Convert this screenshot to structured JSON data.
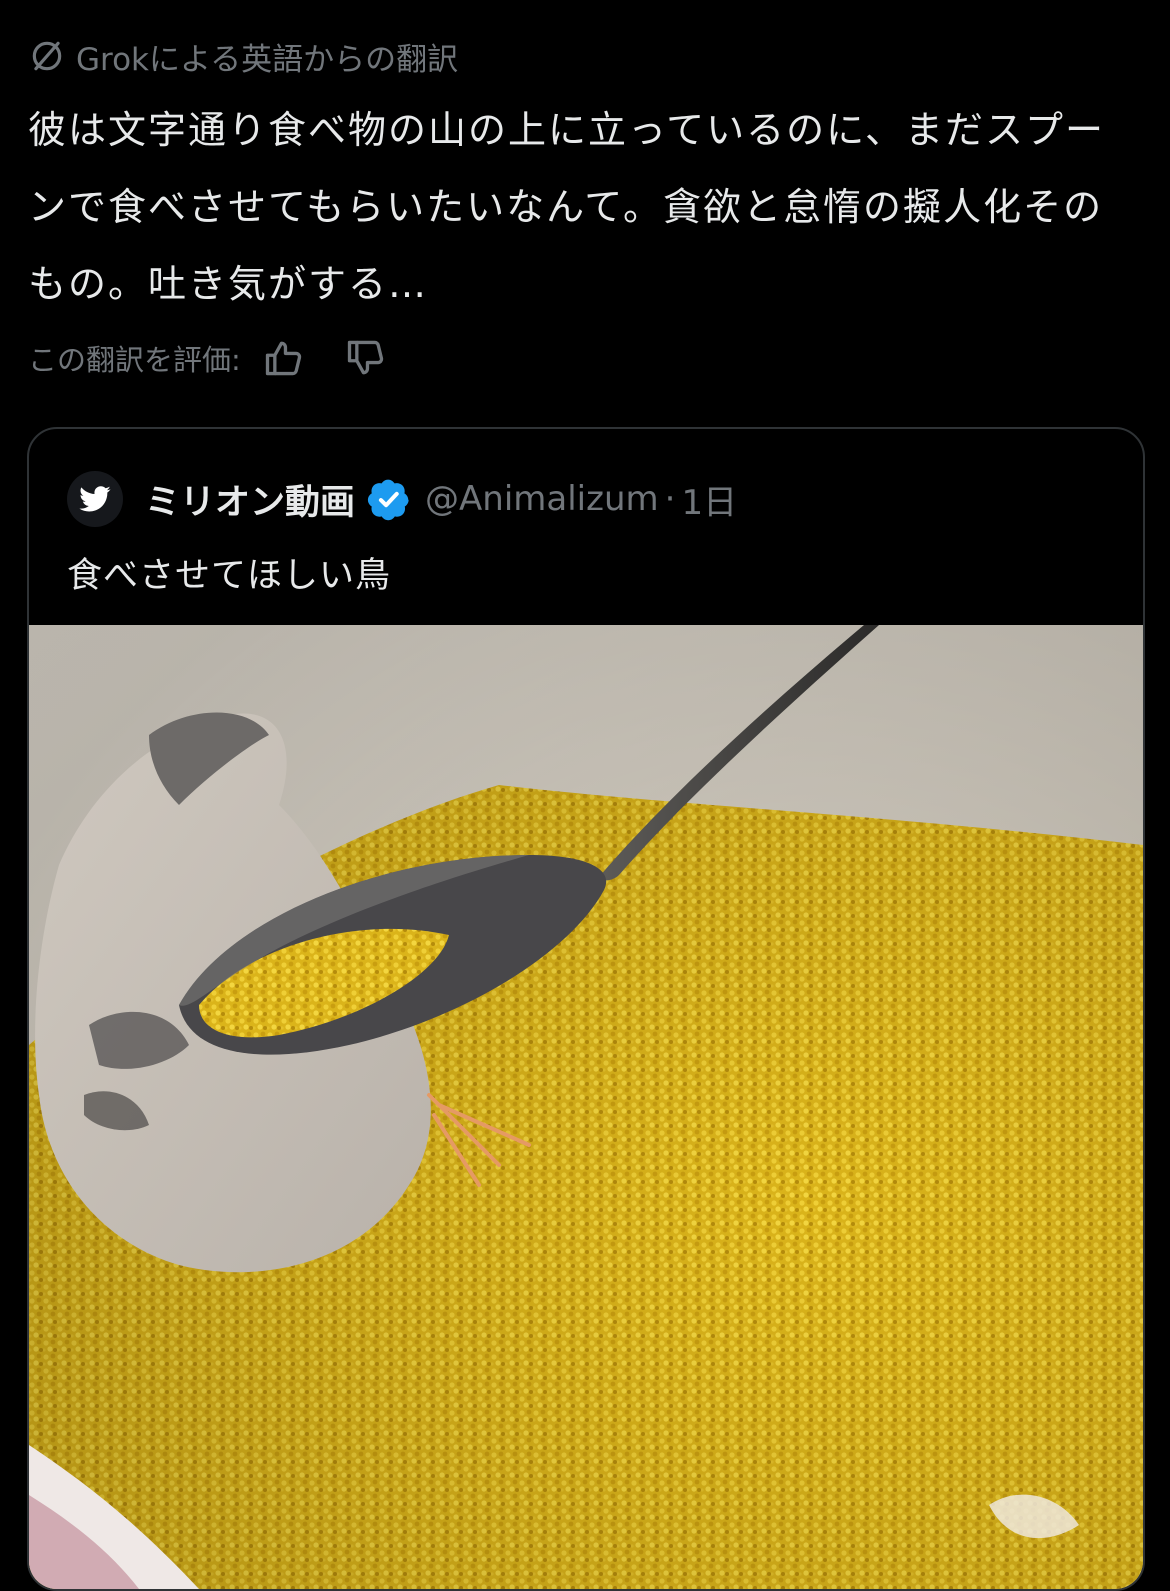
{
  "translation": {
    "label": "Grokによる英語からの翻訳",
    "icon": "slash-circle-icon"
  },
  "post": {
    "text": "彼は文字通り食べ物の山の上に立っているのに、まだスプーンで食べさせてもらいたいなんて。貪欲と怠惰の擬人化そのもの。吐き気がする…"
  },
  "rating": {
    "label": "この翻訳を評価:",
    "icons": [
      "thumbs-up-icon",
      "thumbs-down-icon"
    ]
  },
  "quote": {
    "display_name": "ミリオン動画",
    "handle": "@Animalizum",
    "separator": "·",
    "time": "1日",
    "text": "食べさせてほしい鳥",
    "avatar_icon": "bird-logo-icon",
    "verified_icon": "verified-badge-icon",
    "media_icons": [
      "bird-icon",
      "spoon-icon"
    ]
  },
  "colors": {
    "background": "#000000",
    "text": "#e7e9ea",
    "muted": "#71767b",
    "border": "#2f3336",
    "verified": "#1d9bf0",
    "food": "#e2bb1c"
  }
}
